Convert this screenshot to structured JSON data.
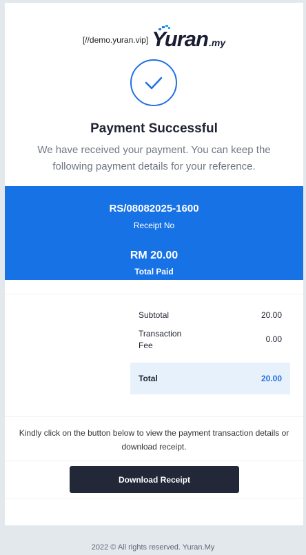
{
  "header": {
    "domain": "[//demo.yuran.vip]",
    "logo_main": "Yuran",
    "logo_sub": ".my"
  },
  "status": {
    "title": "Payment Successful",
    "subtitle": "We have received your payment. You can keep the following payment details for your reference."
  },
  "receipt": {
    "number": "RS/08082025-1600",
    "number_label": "Receipt No",
    "total_amount": "RM 20.00",
    "total_label": "Total Paid"
  },
  "summary": {
    "subtotal_label": "Subtotal",
    "subtotal_value": "20.00",
    "fee_label": "Transaction Fee",
    "fee_value": "0.00",
    "total_label": "Total",
    "total_value": "20.00"
  },
  "instruction": "Kindly click on the button below to view the payment transaction details or download receipt.",
  "download_label": "Download Receipt",
  "footer": "2022 © All rights reserved. Yuran.My",
  "colors": {
    "accent": "#1772e5",
    "button": "#222838",
    "total_bg": "#e7f1fb",
    "page_bg": "#e3e8ed"
  },
  "icons": {
    "status": "check-icon",
    "logo_mark": "pixel-mark-icon"
  }
}
